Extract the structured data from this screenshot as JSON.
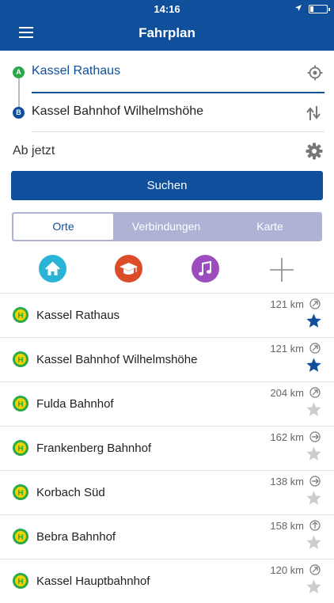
{
  "status_bar": {
    "time": "14:16",
    "location_icon": "location-arrow-icon",
    "battery_level": 0.2
  },
  "header": {
    "title": "Fahrplan",
    "menu_icon": "hamburger-menu-icon"
  },
  "route": {
    "from_marker": "A",
    "to_marker": "B",
    "from": "Kassel Rathaus",
    "to": "Kassel Bahnhof Wilhelmshöhe",
    "locate_icon": "locate-icon",
    "swap_icon": "swap-icon"
  },
  "time_option": {
    "label": "Ab jetzt",
    "settings_icon": "gear-icon"
  },
  "search_button": "Suchen",
  "tabs": [
    {
      "label": "Orte",
      "active": true
    },
    {
      "label": "Verbindungen",
      "active": false
    },
    {
      "label": "Karte",
      "active": false
    }
  ],
  "shortcuts": [
    {
      "icon": "home-icon",
      "color": "#2bb3d7"
    },
    {
      "icon": "graduation-cap-icon",
      "color": "#dc4c28"
    },
    {
      "icon": "music-note-icon",
      "color": "#9b4dbe"
    },
    {
      "icon": "plus-icon",
      "color": "#888888"
    }
  ],
  "colors": {
    "primary": "#0f4f9b",
    "stop_green": "#2aa948",
    "stop_yellow": "#f2d200",
    "star_active": "#0f4f9b",
    "star_inactive": "#cccccc"
  },
  "stops": [
    {
      "name": "Kassel Rathaus",
      "distance": "121 km",
      "favorite": true
    },
    {
      "name": "Kassel Bahnhof Wilhelmshöhe",
      "distance": "121 km",
      "favorite": true
    },
    {
      "name": "Fulda Bahnhof",
      "distance": "204 km",
      "favorite": false
    },
    {
      "name": "Frankenberg Bahnhof",
      "distance": "162 km",
      "favorite": false
    },
    {
      "name": "Korbach Süd",
      "distance": "138 km",
      "favorite": false
    },
    {
      "name": "Bebra Bahnhof",
      "distance": "158 km",
      "favorite": false
    },
    {
      "name": "Kassel Hauptbahnhof",
      "distance": "120 km",
      "favorite": false
    }
  ]
}
